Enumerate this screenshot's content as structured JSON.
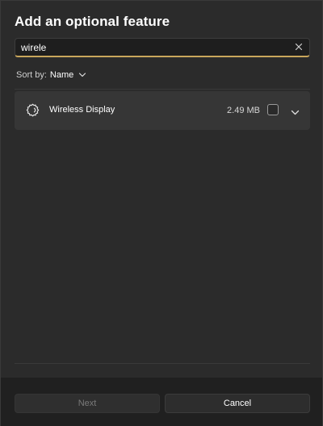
{
  "dialog": {
    "title": "Add an optional feature"
  },
  "search": {
    "value": "wirele",
    "clear_icon": "close-icon",
    "accent_color": "#c9a65b"
  },
  "sort": {
    "label": "Sort by:",
    "value": "Name",
    "icon": "chevron-down-icon"
  },
  "features": [
    {
      "name": "Wireless Display",
      "size": "2.49 MB",
      "checked": false,
      "icon": "puzzle-gear-icon",
      "expand_icon": "chevron-down-icon"
    }
  ],
  "footer": {
    "next_label": "Next",
    "next_enabled": false,
    "cancel_label": "Cancel"
  }
}
